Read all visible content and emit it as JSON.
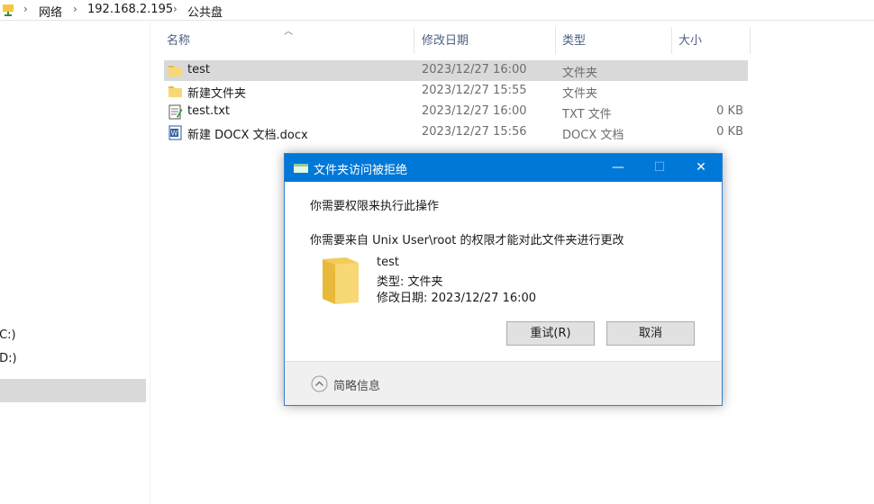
{
  "breadcrumb": {
    "items": [
      "网络",
      "192.168.2.195",
      "公共盘"
    ],
    "separator": "›"
  },
  "nav": {
    "drive_c": "(C:)",
    "drive_d": "(D:)"
  },
  "columns": {
    "name": "名称",
    "modified": "修改日期",
    "type": "类型",
    "size": "大小"
  },
  "files": [
    {
      "name": "test",
      "modified": "2023/12/27 16:00",
      "type": "文件夹",
      "size": "",
      "icon": "folder-icon"
    },
    {
      "name": "新建文件夹",
      "modified": "2023/12/27 15:55",
      "type": "文件夹",
      "size": "",
      "icon": "folder-icon"
    },
    {
      "name": "test.txt",
      "modified": "2023/12/27 16:00",
      "type": "TXT 文件",
      "size": "0 KB",
      "icon": "text-file-icon"
    },
    {
      "name": "新建 DOCX 文档.docx",
      "modified": "2023/12/27 15:56",
      "type": "DOCX 文档",
      "size": "0 KB",
      "icon": "word-document-icon"
    }
  ],
  "dialog": {
    "title": "文件夹访问被拒绝",
    "minimize": "—",
    "maximize": "☐",
    "close": "✕",
    "message1": "你需要权限来执行此操作",
    "message2": "你需要来自 Unix User\\root 的权限才能对此文件夹进行更改",
    "item_name": "test",
    "item_type": "类型: 文件夹",
    "item_modified": "修改日期: 2023/12/27 16:00",
    "retry_label": "重试(R)",
    "cancel_label": "取消",
    "details_label": "简略信息"
  },
  "colors": {
    "titlebar": "#0078d7",
    "selection": "#d9d9d9",
    "folder": "#f8d775",
    "header_text": "#4d6082"
  }
}
